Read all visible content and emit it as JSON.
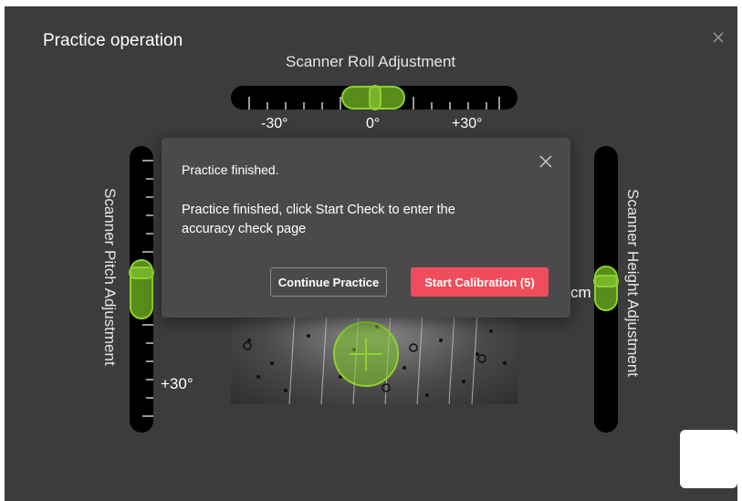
{
  "window": {
    "title": "Practice operation"
  },
  "roll": {
    "label": "Scanner Roll Adjustment",
    "ticks": [
      "-30°",
      "0°",
      "+30°"
    ]
  },
  "pitch": {
    "label": "Scanner Pitch Adjustment",
    "tick": "+30°",
    "partial": "("
  },
  "height": {
    "label": "Scanner Height Adjustment",
    "partial_unit": "cm"
  },
  "dialog": {
    "title": "Practice finished.",
    "body": "Practice finished, click Start Check to enter the accuracy check page",
    "continue_label": "Continue Practice",
    "start_label": "Start Calibration (5)"
  },
  "colors": {
    "accent_green": "#8fd12e",
    "primary_red": "#ef4d5b",
    "panel_bg": "#3c3c3c"
  }
}
